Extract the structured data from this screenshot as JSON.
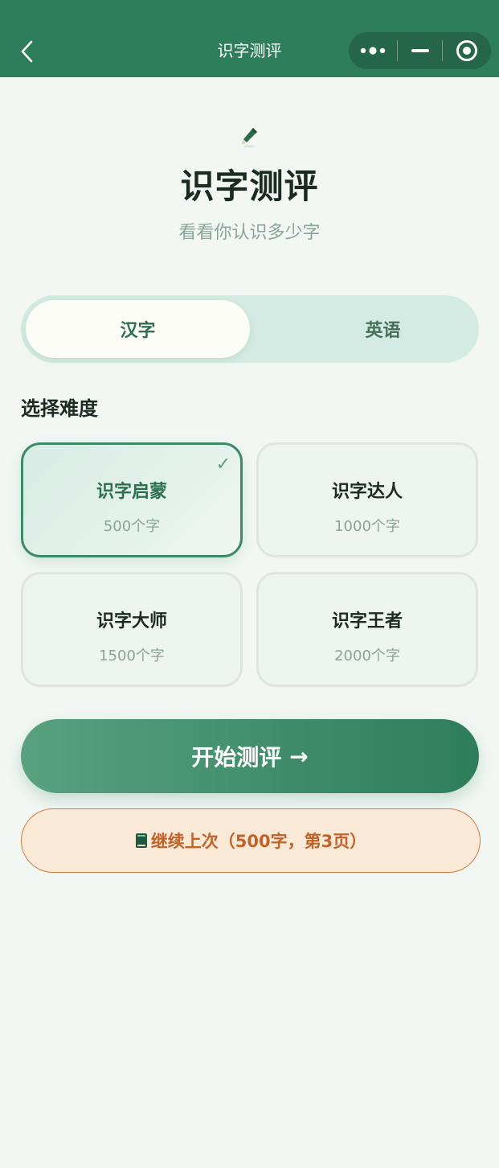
{
  "navbar": {
    "title": "识字测评",
    "icons": {
      "back": "chevron-left-icon",
      "more": "more-dots-icon",
      "minimize": "minus-icon",
      "close": "target-circle-icon"
    },
    "color": "#2e7d5b"
  },
  "hero": {
    "icon": "pencil-icon",
    "title": "识字测评",
    "subtitle": "看看你认识多少字"
  },
  "language_toggle": {
    "options": [
      {
        "label": "汉字",
        "selected": true
      },
      {
        "label": "英语",
        "selected": false
      }
    ]
  },
  "difficulty": {
    "label": "选择难度",
    "check": "✓",
    "levels": [
      {
        "name": "识字启蒙",
        "count": "500个字",
        "selected": true
      },
      {
        "name": "识字达人",
        "count": "1000个字",
        "selected": false
      },
      {
        "name": "识字大师",
        "count": "1500个字",
        "selected": false
      },
      {
        "name": "识字王者",
        "count": "2000个字",
        "selected": false
      }
    ]
  },
  "start_button": {
    "label": "开始测评",
    "arrow": "→"
  },
  "continue_button": {
    "icon": "book-icon",
    "label": "继续上次（500字，第3页）"
  },
  "colors": {
    "accent": "#2e7d5b",
    "continue": "#c0632a",
    "continue_bg": "#fae9d6"
  }
}
